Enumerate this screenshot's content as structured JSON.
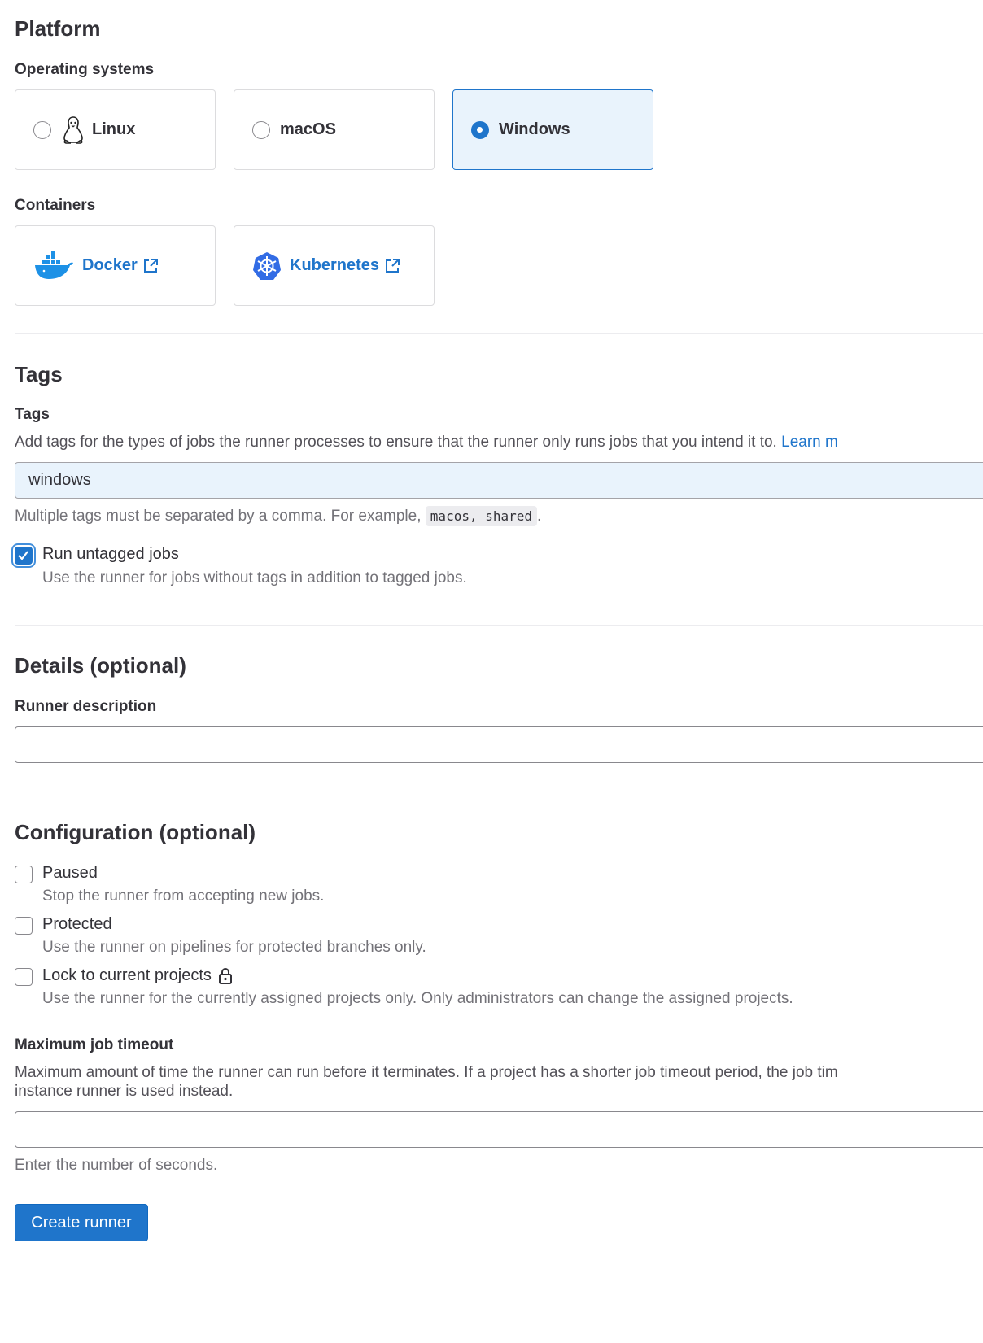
{
  "platform": {
    "title": "Platform",
    "os_label": "Operating systems",
    "os_options": [
      {
        "label": "Linux",
        "selected": false,
        "icon": "linux-tux-icon"
      },
      {
        "label": "macOS",
        "selected": false
      },
      {
        "label": "Windows",
        "selected": true
      }
    ],
    "containers_label": "Containers",
    "containers": [
      {
        "label": "Docker",
        "icon": "docker-whale-icon"
      },
      {
        "label": "Kubernetes",
        "icon": "kubernetes-helm-icon"
      }
    ]
  },
  "tags": {
    "section_title": "Tags",
    "field_label": "Tags",
    "description": "Add tags for the types of jobs the runner processes to ensure that the runner only runs jobs that you intend it to.",
    "learn_more": "Learn m",
    "value": "windows",
    "help_prefix": "Multiple tags must be separated by a comma. For example,",
    "help_code": "macos, shared",
    "help_suffix": ".",
    "run_untagged": {
      "label": "Run untagged jobs",
      "help": "Use the runner for jobs without tags in addition to tagged jobs.",
      "checked": true
    }
  },
  "details": {
    "section_title": "Details (optional)",
    "description_label": "Runner description",
    "description_value": ""
  },
  "configuration": {
    "section_title": "Configuration (optional)",
    "options": [
      {
        "label": "Paused",
        "help": "Stop the runner from accepting new jobs.",
        "checked": false
      },
      {
        "label": "Protected",
        "help": "Use the runner on pipelines for protected branches only.",
        "checked": false
      },
      {
        "label": "Lock to current projects",
        "help": "Use the runner for the currently assigned projects only. Only administrators can change the assigned projects.",
        "checked": false,
        "icon": "lock-icon"
      }
    ],
    "timeout_label": "Maximum job timeout",
    "timeout_description_line1": "Maximum amount of time the runner can run before it terminates. If a project has a shorter job timeout period, the job tim",
    "timeout_description_line2": "instance runner is used instead.",
    "timeout_value": "",
    "timeout_help": "Enter the number of seconds."
  },
  "actions": {
    "create_label": "Create runner"
  },
  "colors": {
    "accent": "#1f75cb",
    "selected_bg": "#e9f3fc",
    "text": "#333238",
    "muted": "#737278"
  }
}
